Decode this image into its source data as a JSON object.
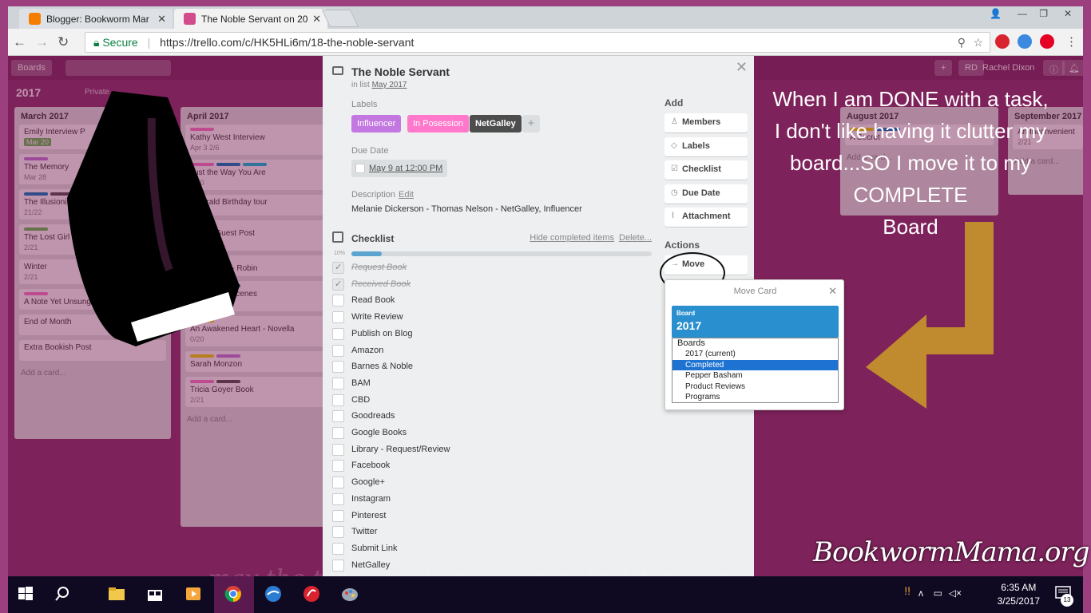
{
  "browser": {
    "tabs": [
      {
        "title": "Blogger: Bookworm Mar",
        "color": "#f57d00"
      },
      {
        "title": "The Noble Servant on 20",
        "color": "#d24b8a"
      }
    ],
    "secure_label": "Secure",
    "url": "https://trello.com/c/HK5HLi6m/18-the-noble-servant"
  },
  "trello": {
    "boards_btn": "Boards",
    "board_title": "2017",
    "visibility": "Private",
    "user_initials": "RD",
    "user_name": "Rachel Dixon",
    "lists": [
      {
        "title": "March 2017",
        "cards": [
          {
            "title": "Emily Interview P",
            "badge": "Mar 20"
          },
          {
            "title": "The Memory",
            "meta": "Mar 28"
          },
          {
            "title": "The Illusionist",
            "meta": "21/22"
          },
          {
            "title": "The Lost Girl of As",
            "meta": "2/21"
          },
          {
            "title": "Winter",
            "meta": "2/21"
          },
          {
            "title": "A Note Yet Unsung"
          },
          {
            "title": "End of Month"
          },
          {
            "title": "Extra Bookish Post"
          }
        ],
        "add": "Add a card..."
      },
      {
        "title": "April 2017",
        "cards": [
          {
            "title": "Kathy West Interview",
            "meta": "Apr 3   2/6"
          },
          {
            "title": "Just the Way You Are",
            "meta": "3/20"
          },
          {
            "title": "Emerald Birthday tour"
          },
          {
            "title": "Buffy - Guest Post",
            "meta": "0/8"
          },
          {
            "title": "Guest Post - Robin"
          },
          {
            "title": "Behind the Scenes",
            "meta": "Apr 29   1/20"
          },
          {
            "title": "An Awakened Heart - Novella",
            "meta": "0/20"
          },
          {
            "title": "Sarah Monzon"
          },
          {
            "title": "Tricia Goyer Book",
            "meta": "2/21"
          }
        ],
        "add": "Add a card..."
      },
      {
        "title": "August 2017",
        "cards": [
          {
            "title": "A Secret"
          }
        ],
        "add": "Add a card..."
      },
      {
        "title": "September 2017",
        "cards": [
          {
            "title": "An Inconvenient",
            "meta": "2/21"
          }
        ],
        "add": "Add a card..."
      }
    ]
  },
  "card": {
    "title": "The Noble Servant",
    "in_list_prefix": "in list",
    "in_list": "May 2017",
    "labels_heading": "Labels",
    "labels": [
      {
        "text": "Influencer",
        "color": "#c377e0"
      },
      {
        "text": "In Posession",
        "color": "#ff78cb"
      },
      {
        "text": "NetGalley",
        "color": "#4d4d4d"
      }
    ],
    "label_add": "+",
    "due_heading": "Due Date",
    "due_value": "May 9 at 12:00 PM",
    "desc_heading": "Description",
    "desc_edit": "Edit",
    "description": "Melanie Dickerson - Thomas Nelson - NetGalley, Influencer",
    "checklist_title": "Checklist",
    "hide_completed": "Hide completed items",
    "delete": "Delete...",
    "progress_pct": "10%",
    "progress": 0.1,
    "items": [
      {
        "text": "Request Book",
        "done": true
      },
      {
        "text": "Received Book",
        "done": true
      },
      {
        "text": "Read Book",
        "done": false
      },
      {
        "text": "Write Review",
        "done": false
      },
      {
        "text": "Publish on Blog",
        "done": false
      },
      {
        "text": "Amazon",
        "done": false
      },
      {
        "text": "Barnes & Noble",
        "done": false
      },
      {
        "text": "BAM",
        "done": false
      },
      {
        "text": "CBD",
        "done": false
      },
      {
        "text": "Goodreads",
        "done": false
      },
      {
        "text": "Google Books",
        "done": false
      },
      {
        "text": "Library - Request/Review",
        "done": false
      },
      {
        "text": "Facebook",
        "done": false
      },
      {
        "text": "Google+",
        "done": false
      },
      {
        "text": "Instagram",
        "done": false
      },
      {
        "text": "Pinterest",
        "done": false
      },
      {
        "text": "Twitter",
        "done": false
      },
      {
        "text": "Submit Link",
        "done": false
      },
      {
        "text": "NetGalley",
        "done": false
      }
    ],
    "add_heading": "Add",
    "add_buttons": [
      {
        "text": "Members",
        "icon": "person-icon"
      },
      {
        "text": "Labels",
        "icon": "tag-icon"
      },
      {
        "text": "Checklist",
        "icon": "checkbox-icon"
      },
      {
        "text": "Due Date",
        "icon": "clock-icon"
      },
      {
        "text": "Attachment",
        "icon": "paperclip-icon"
      }
    ],
    "actions_heading": "Actions",
    "move_label": "Move"
  },
  "move_popover": {
    "title": "Move Card",
    "board_label": "Board",
    "board_value": "2017",
    "group_label": "Boards",
    "options": [
      {
        "text": "2017 (current)",
        "selected": false
      },
      {
        "text": "Completed",
        "selected": true
      },
      {
        "text": "Pepper Basham",
        "selected": false
      },
      {
        "text": "Product Reviews",
        "selected": false
      },
      {
        "text": "Programs",
        "selected": false
      }
    ]
  },
  "annotation": {
    "lines": [
      "When I am DONE with a task,",
      "I don't like having it clutter my",
      "board...SO I move it to my",
      "COMPLETE",
      "Board"
    ],
    "arrow_color": "#c08a2e"
  },
  "watermark": "BookwormMama.org",
  "background_quote": "may the treasure is man's greatest treasure",
  "taskbar": {
    "time": "6:35 AM",
    "date": "3/25/2017",
    "notifications": "13"
  }
}
